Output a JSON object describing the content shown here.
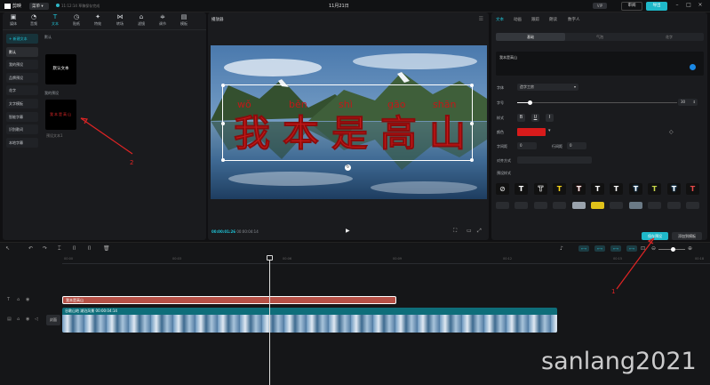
{
  "topbar": {
    "logo": "剪映",
    "menu": "菜单",
    "autosave": "11:12:14 草稿保存完成",
    "date": "11月21日",
    "badge": "VIP",
    "share": "审阅",
    "export": "导出"
  },
  "media_tabs": [
    {
      "label": "媒体",
      "icon": "media-icon"
    },
    {
      "label": "音频",
      "icon": "audio-icon"
    },
    {
      "label": "文本",
      "icon": "text-icon"
    },
    {
      "label": "贴纸",
      "icon": "sticker-icon"
    },
    {
      "label": "特效",
      "icon": "effects-icon"
    },
    {
      "label": "转场",
      "icon": "transition-icon"
    },
    {
      "label": "滤镜",
      "icon": "filter-icon"
    },
    {
      "label": "调节",
      "icon": "adjust-icon"
    },
    {
      "label": "模板",
      "icon": "template-icon"
    }
  ],
  "text_categories": [
    "+ 新建文本",
    "默认",
    "我的预设",
    "花字",
    "文字模板",
    "智能字幕",
    "识别歌词",
    "本地字幕"
  ],
  "text_panel": {
    "extra_category": "品牌预设",
    "section_default": "默认",
    "default_card": "默认文本",
    "section_mine": "我的预设",
    "mine_card": "我本是高山",
    "mine_card_label": "预设文本1"
  },
  "player": {
    "title": "播放器",
    "timecode_current": "00:00:01:26",
    "timecode_total": "00:00:04:14",
    "overlay_text": "我本是高山",
    "pinyin": [
      "wǒ",
      "běn",
      "shì",
      "gāo",
      "shān"
    ]
  },
  "props": {
    "tabs": [
      "文本",
      "动画",
      "跟踪",
      "朗读",
      "数字人"
    ],
    "subtabs": [
      "基础",
      "气泡",
      "花字"
    ],
    "text_value": "我本是高山",
    "font_label": "字体",
    "font_value": "造字工房",
    "size_label": "字号",
    "size_value": "30",
    "style_label": "样式",
    "format_buttons": [
      "B",
      "U",
      "I"
    ],
    "color_label": "颜色",
    "spacing_label": "字间距",
    "spacing_value": "0",
    "line_spacing_label": "行间距",
    "line_spacing_value": "0",
    "align_label": "对齐方式",
    "preset_label": "预设样式",
    "save_preset": "保存预设",
    "add_template": "添加到模板",
    "color_hex": "#d81b1b"
  },
  "timeline": {
    "ticks": [
      "00:00",
      "00:03",
      "00:06",
      "00:09",
      "00:12",
      "00:15",
      "00:18"
    ],
    "text_clip": "我本是高山",
    "video_clip": "谷歌山地 湖泊风景 00:00:04:14",
    "cover": "封面"
  },
  "annotations": [
    "1",
    "2"
  ],
  "watermark": "sanlang2021"
}
